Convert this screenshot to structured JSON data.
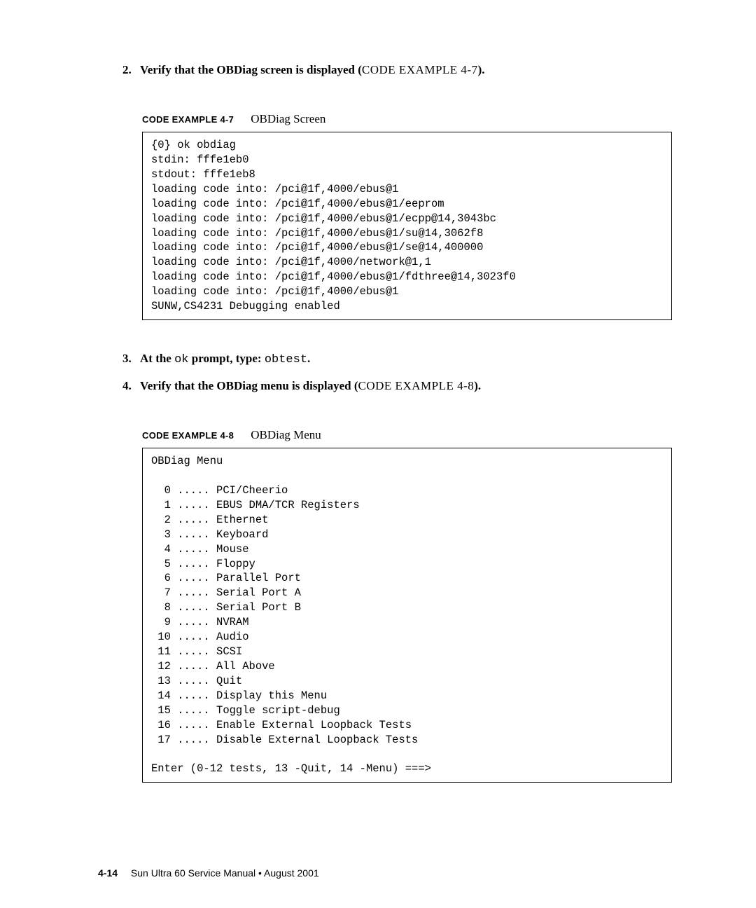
{
  "steps": {
    "step2": {
      "number": "2.",
      "text_bold": "Verify that the OBDiag screen is displayed (",
      "text_caps": "CODE EXAMPLE 4-7",
      "text_end": ")."
    },
    "step3": {
      "number": "3.",
      "text_bold1": "At the ",
      "mono1": "ok",
      "text_bold2": " prompt, type: ",
      "mono2": "obtest",
      "text_end": "."
    },
    "step4": {
      "number": "4.",
      "text_bold": "Verify that the OBDiag menu is displayed (",
      "text_caps": "CODE EXAMPLE 4-8",
      "text_end": ")."
    }
  },
  "code_example_47": {
    "label": "CODE EXAMPLE 4-7",
    "title": "OBDiag Screen",
    "content": "{0} ok obdiag\nstdin: fffe1eb0\nstdout: fffe1eb8\nloading code into: /pci@1f,4000/ebus@1\nloading code into: /pci@1f,4000/ebus@1/eeprom\nloading code into: /pci@1f,4000/ebus@1/ecpp@14,3043bc\nloading code into: /pci@1f,4000/ebus@1/su@14,3062f8\nloading code into: /pci@1f,4000/ebus@1/se@14,400000\nloading code into: /pci@1f,4000/network@1,1\nloading code into: /pci@1f,4000/ebus@1/fdthree@14,3023f0\nloading code into: /pci@1f,4000/ebus@1\nSUNW,CS4231 Debugging enabled"
  },
  "code_example_48": {
    "label": "CODE EXAMPLE 4-8",
    "title": "OBDiag Menu",
    "content": "OBDiag Menu\n\n  0 ..... PCI/Cheerio\n  1 ..... EBUS DMA/TCR Registers\n  2 ..... Ethernet\n  3 ..... Keyboard\n  4 ..... Mouse\n  5 ..... Floppy\n  6 ..... Parallel Port\n  7 ..... Serial Port A\n  8 ..... Serial Port B\n  9 ..... NVRAM\n 10 ..... Audio\n 11 ..... SCSI\n 12 ..... All Above\n 13 ..... Quit\n 14 ..... Display this Menu\n 15 ..... Toggle script-debug\n 16 ..... Enable External Loopback Tests\n 17 ..... Disable External Loopback Tests\n\nEnter (0-12 tests, 13 -Quit, 14 -Menu) ===>"
  },
  "footer": {
    "page": "4-14",
    "text": "Sun Ultra 60 Service Manual • August 2001"
  }
}
